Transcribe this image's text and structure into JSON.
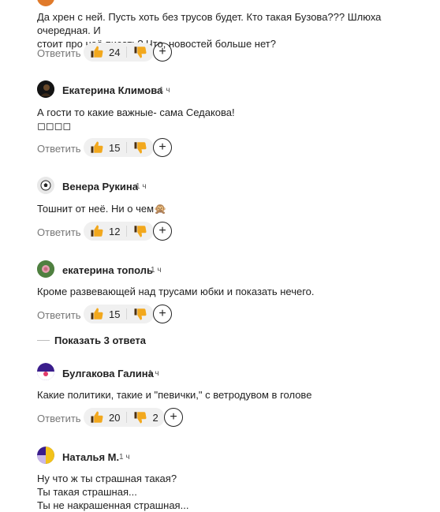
{
  "reply_label": "Ответить",
  "show_replies": "Показать 3 ответа",
  "comments": [
    {
      "id": "c0",
      "name": "",
      "time": "",
      "lines": [
        "Да хрен с ней. Пусть хоть без трусов будет. Кто такая Бузова??? Шлюха очередная. И",
        "стоит про неё писать? Что, новостей больше нет?"
      ],
      "likes": "24",
      "dislikes": ""
    },
    {
      "id": "c1",
      "name": "Екатерина Климова",
      "time": "1 ч",
      "lines": [
        "А гости то какие важные- сама Седакова!",
        "◻◻◻◻"
      ],
      "likes": "15",
      "dislikes": ""
    },
    {
      "id": "c2",
      "name": "Венера Рукина",
      "time": "1 ч",
      "lines": [
        "Тошнит от неё. Ни о чем🙊"
      ],
      "likes": "12",
      "dislikes": ""
    },
    {
      "id": "c3",
      "name": "екатерина тополь",
      "time": "1 ч",
      "lines": [
        "Кроме развевающей над трусами юбки и показать нечего."
      ],
      "likes": "15",
      "dislikes": ""
    },
    {
      "id": "c4",
      "name": "Булгакова Галина",
      "time": "1 ч",
      "lines": [
        "Какие политики, такие и \"певички,\" с ветродувом в голове"
      ],
      "likes": "20",
      "dislikes": "2"
    },
    {
      "id": "c5",
      "name": "Наталья М.",
      "time": "1 ч",
      "lines": [
        "Ну что ж ты страшная такая?",
        "Ты такая страшная...",
        "Ты не накрашенная страшная..."
      ],
      "likes": "",
      "dislikes": ""
    }
  ],
  "colors": {
    "thumb": "#f2a81d",
    "thumb_dark": "#4b3010",
    "accent_avatar": "#3a1d8c"
  }
}
